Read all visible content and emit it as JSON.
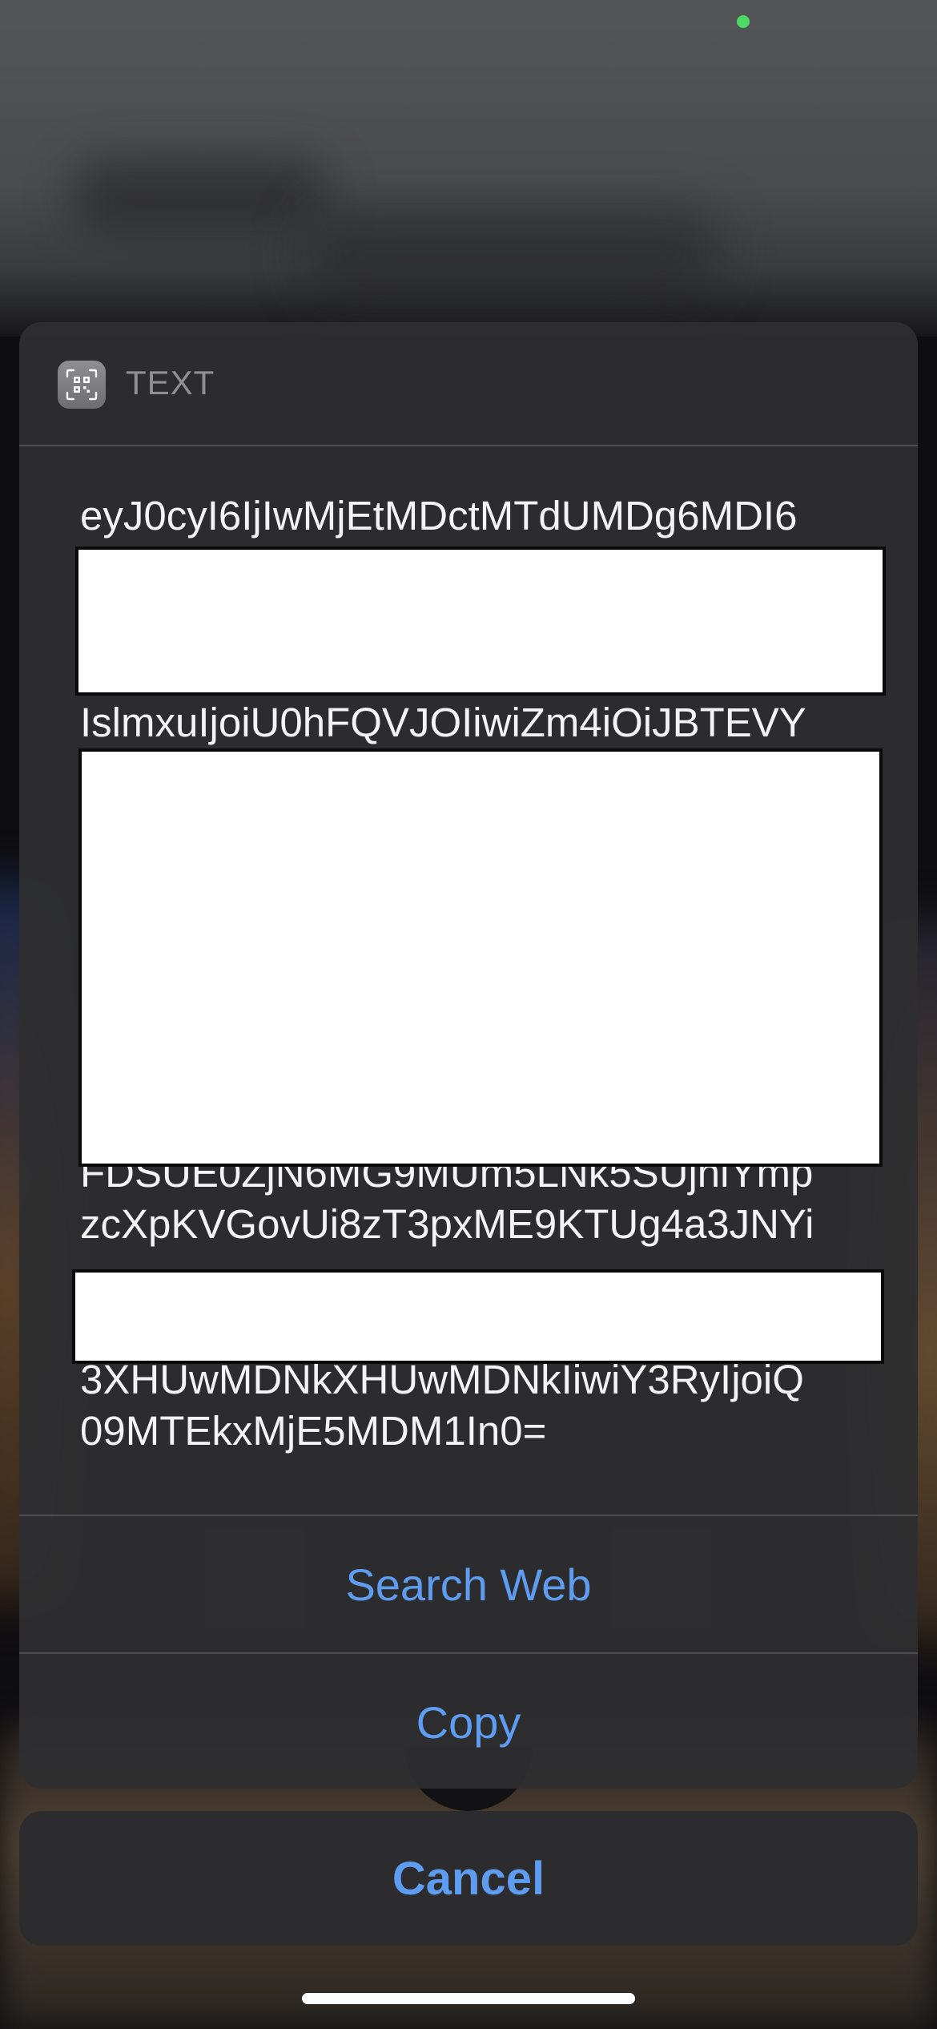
{
  "sheet": {
    "header_title": "TEXT",
    "header_icon": "qr-code-scanner-icon",
    "payload_lines": [
      "eyJ0cyI6IjIwMjEtMDctMTdUMDg6MDI6",
      "IslmxuIjoiU0hFQVJOIiwiZm4iOiJBTEVY",
      "FDSUE0ZjN6MG9MUm5LNk5SUjhiYmp",
      "zcXpKVGovUi8zT3pxME9KTUg4a3JNYi",
      "3XHUwMDNkXHUwMDNkIiwiY3RyIjoiQ",
      "09MTEkxMjE5MDM1In0="
    ],
    "actions": {
      "search_web": "Search Web",
      "copy": "Copy"
    }
  },
  "cancel_label": "Cancel",
  "colors": {
    "accent": "#5e9cf0",
    "sheet_bg": "#2e2e30",
    "status_dot": "#4cd964"
  }
}
